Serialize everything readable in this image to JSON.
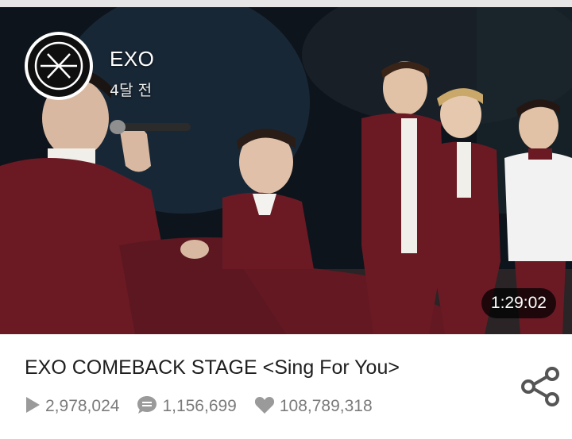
{
  "video": {
    "channel_name": "EXO",
    "upload_time": "4달 전",
    "duration": "1:29:02"
  },
  "info": {
    "title": "EXO COMEBACK STAGE <Sing For You>",
    "stats": {
      "plays": "2,978,024",
      "comments": "1,156,699",
      "likes": "108,789,318"
    }
  },
  "icons": {
    "channel_logo": "exo-logo-icon",
    "plays": "play-icon",
    "comments": "comment-bubble-icon",
    "likes": "heart-icon",
    "share": "share-icon"
  },
  "colors": {
    "title_text": "#1e1e1e",
    "stat_text": "#7b7b7b",
    "icon_gray": "#9a9a9a",
    "share_icon": "#555555",
    "suit_maroon": "#6b1a24"
  }
}
